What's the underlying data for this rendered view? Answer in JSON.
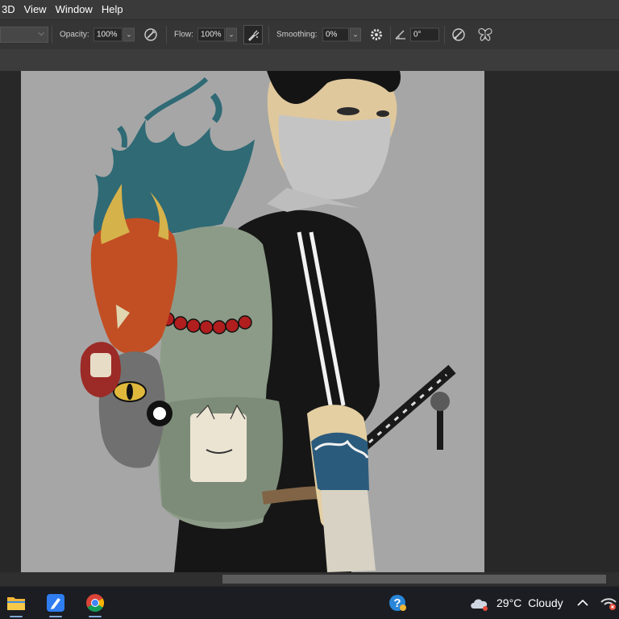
{
  "menu": {
    "items": [
      "3D",
      "View",
      "Window",
      "Help"
    ]
  },
  "options": {
    "opacity_label": "Opacity:",
    "opacity_value": "100%",
    "flow_label": "Flow:",
    "flow_value": "100%",
    "smoothing_label": "Smoothing:",
    "smoothing_value": "0%",
    "angle_value": "0°",
    "icons": [
      "chevron-down-icon",
      "pressure-opacity-icon",
      "airbrush-icon",
      "settings-gear-icon",
      "angle-icon",
      "pressure-size-icon",
      "symmetry-butterfly-icon"
    ]
  },
  "canvas": {
    "background": "#a6a6a6"
  },
  "taskbar": {
    "apps": [
      "file-explorer-icon",
      "notes-app-icon",
      "chrome-icon"
    ],
    "help_icon": "help-question-icon",
    "weather": {
      "temperature": "29°C",
      "condition": "Cloudy"
    },
    "tray_chevron": "chevron-up-icon",
    "network_icon": "network-warning-icon"
  },
  "colors": {
    "menubar": "#3a3a3a",
    "optionsbar": "#353535",
    "workspace": "#282828",
    "taskbar": "#1b1d23"
  }
}
